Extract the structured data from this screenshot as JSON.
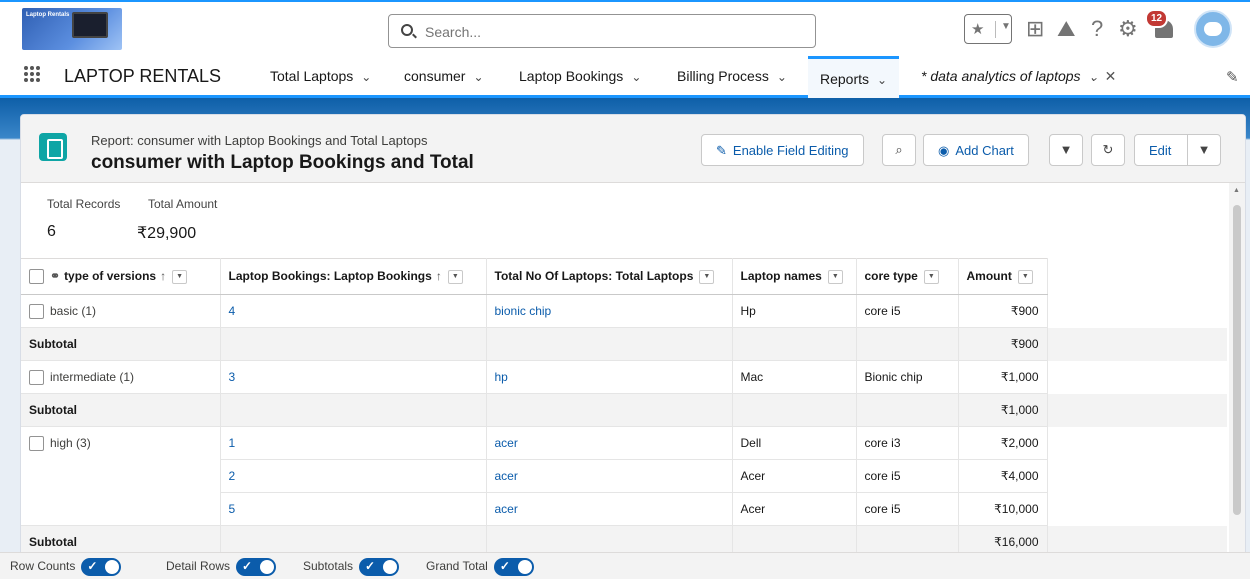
{
  "header": {
    "logo_text": "Laptop Rentals",
    "search_placeholder": "Search...",
    "notification_count": "12"
  },
  "nav": {
    "app_name": "LAPTOP RENTALS",
    "tabs": [
      {
        "label": "Total Laptops"
      },
      {
        "label": "consumer"
      },
      {
        "label": "Laptop Bookings"
      },
      {
        "label": "Billing Process"
      },
      {
        "label": "Reports"
      },
      {
        "label": "* data analytics of laptops"
      }
    ]
  },
  "report": {
    "subtitle": "Report: consumer with Laptop Bookings and Total Laptops",
    "title": "consumer with Laptop Bookings and Total",
    "buttons": {
      "enable_field_editing": "Enable Field Editing",
      "add_chart": "Add Chart",
      "edit": "Edit"
    },
    "summary": {
      "total_records_label": "Total Records",
      "total_records": "6",
      "total_amount_label": "Total Amount",
      "total_amount": "₹29,900"
    },
    "columns": [
      "type of versions",
      "Laptop Bookings: Laptop Bookings",
      "Total No Of Laptops: Total Laptops",
      "Laptop names",
      "core type",
      "Amount"
    ],
    "groups": [
      {
        "label": "basic (1)",
        "rows": [
          {
            "booking": "4",
            "total": "bionic chip",
            "name": "Hp",
            "core": "core i5",
            "amount": "₹900"
          }
        ],
        "subtotal": "₹900"
      },
      {
        "label": "intermediate (1)",
        "rows": [
          {
            "booking": "3",
            "total": "hp",
            "name": "Mac",
            "core": "Bionic chip",
            "amount": "₹1,000"
          }
        ],
        "subtotal": "₹1,000"
      },
      {
        "label": "high (3)",
        "rows": [
          {
            "booking": "1",
            "total": "acer",
            "name": "Dell",
            "core": "core i3",
            "amount": "₹2,000"
          },
          {
            "booking": "2",
            "total": "acer",
            "name": "Acer",
            "core": "core i5",
            "amount": "₹4,000"
          },
          {
            "booking": "5",
            "total": "acer",
            "name": "Acer",
            "core": "core i5",
            "amount": "₹10,000"
          }
        ],
        "subtotal": "₹16,000"
      }
    ],
    "subtotal_label": "Subtotal"
  },
  "footer": {
    "row_counts": "Row Counts",
    "detail_rows": "Detail Rows",
    "subtotals": "Subtotals",
    "grand_total": "Grand Total"
  },
  "colors": {
    "accent": "#1b96ff",
    "link": "#0b5cab",
    "report_icon": "#0ea5a5",
    "badge": "#c23934"
  },
  "icons": [
    "search-icon",
    "favorites-star-icon",
    "add-icon",
    "trailhead-icon",
    "help-icon",
    "setup-gear-icon",
    "notification-bell-icon",
    "app-launcher-icon",
    "pencil-icon",
    "report-icon",
    "filter-icon",
    "refresh-icon",
    "chevron-down-icon",
    "close-icon"
  ]
}
